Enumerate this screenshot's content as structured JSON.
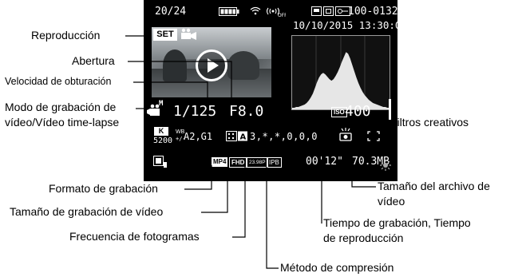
{
  "screen": {
    "frame_counter": "20/24",
    "file_number": "100-0132",
    "datetime": "10/10/2015 13:30:00",
    "set_label": "SET",
    "shutter_speed": "1/125",
    "aperture": "F8.0",
    "iso_badge": "ISO",
    "iso_value": "400",
    "movie_mode_superscript": "M",
    "wb_shift_label": "WB",
    "wb_shift_value": "A2,G1",
    "picture_style_values": "3,*,*,0,0,0",
    "color_temp_badge": "K",
    "color_temp": "5200",
    "format_badge": "MP4",
    "size_badge": "FHD",
    "frame_rate_badge": "23.98P",
    "compression_badge": "IPB",
    "record_time": "00'12\"",
    "file_size": "70.3MB"
  },
  "callouts": {
    "playback": "Reproducción",
    "aperture": "Abertura",
    "shutter_speed": "Velocidad de obturación",
    "movie_mode_line1": "Modo de grabación de",
    "movie_mode_line2": "vídeo/Vídeo time-lapse",
    "creative_filters": "Filtros creativos",
    "recording_format": "Formato de grabación",
    "file_size_line1": "Tamaño del archivo de",
    "file_size_line2": "vídeo",
    "movie_size": "Tamaño de grabación de vídeo",
    "recording_time_line1": "Tiempo de grabación, Tiempo",
    "recording_time_line2": "de reproducción",
    "frame_rate": "Frecuencia de fotogramas",
    "compression": "Método de compresión"
  },
  "histogram": [
    2,
    2,
    3,
    3,
    4,
    5,
    6,
    8,
    11,
    15,
    20,
    27,
    34,
    40,
    44,
    46,
    44,
    41,
    38,
    36,
    38,
    42,
    47,
    53,
    60,
    66,
    72,
    70,
    64,
    56,
    48,
    40,
    33,
    27,
    22,
    18,
    15,
    12,
    10,
    8,
    7,
    6,
    5,
    4,
    3,
    3,
    2,
    2
  ],
  "colors": {
    "screen_bg": "#000000",
    "text": "#ffffff",
    "leader": "#000000"
  }
}
